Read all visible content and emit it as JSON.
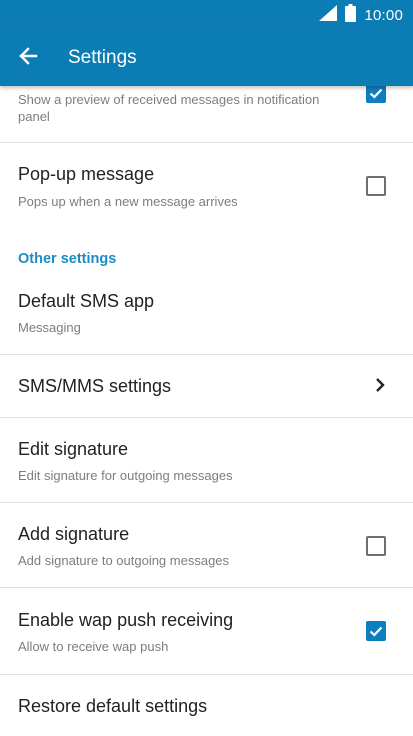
{
  "status": {
    "time": "10:00"
  },
  "appbar": {
    "title": "Settings"
  },
  "items": {
    "preview": {
      "subtitle_line1": "Show a preview of received messages in notification",
      "subtitle_line2": "panel",
      "checked": true
    },
    "popup": {
      "title": "Pop-up message",
      "subtitle": "Pops up when a new message arrives",
      "checked": false
    },
    "default_sms": {
      "title": "Default SMS app",
      "subtitle": "Messaging"
    },
    "sms_mms": {
      "title": "SMS/MMS settings"
    },
    "edit_signature": {
      "title": "Edit signature",
      "subtitle": "Edit signature for outgoing messages"
    },
    "add_signature": {
      "title": "Add signature",
      "subtitle": "Add signature to outgoing messages",
      "checked": false
    },
    "wap_push": {
      "title": "Enable wap push receiving",
      "subtitle": "Allow to receive wap push",
      "checked": true
    },
    "restore": {
      "title": "Restore default settings"
    }
  },
  "sections": {
    "other": "Other settings"
  },
  "colors": {
    "primary": "#0c7cb4",
    "accent": "#1e8bc3",
    "checkbox_checked": "#0e7ec0"
  }
}
